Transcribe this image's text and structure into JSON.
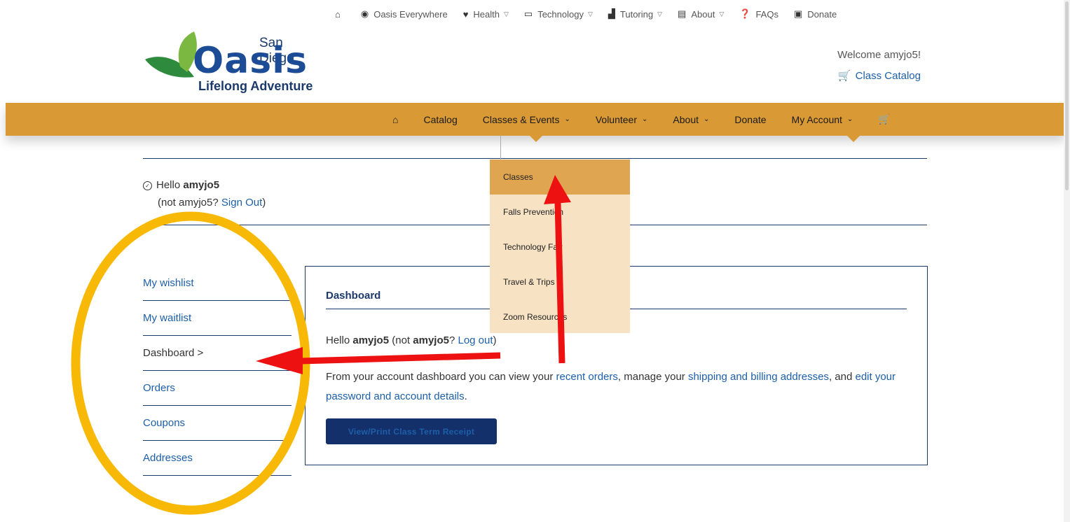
{
  "topnav": {
    "items": [
      {
        "label": "",
        "icon": "home-icon"
      },
      {
        "label": "Oasis Everywhere",
        "icon": "globe-icon"
      },
      {
        "label": "Health",
        "icon": "heart-icon",
        "dropdown": true
      },
      {
        "label": "Technology",
        "icon": "laptop-icon",
        "dropdown": true
      },
      {
        "label": "Tutoring",
        "icon": "teacher-icon",
        "dropdown": true
      },
      {
        "label": "About",
        "icon": "chalkboard-icon",
        "dropdown": true
      },
      {
        "label": "FAQs",
        "icon": "question-circle-icon"
      },
      {
        "label": "Donate",
        "icon": "gift-icon"
      }
    ]
  },
  "logo": {
    "line1": "San Diego",
    "line2": "Oasis",
    "line3": "Lifelong Adventure"
  },
  "header": {
    "welcome": "Welcome amyjo5!",
    "catalog_link": "Class Catalog"
  },
  "mainnav": {
    "catalog": "Catalog",
    "classes_events": "Classes & Events",
    "volunteer": "Volunteer",
    "about": "About",
    "donate": "Donate",
    "my_account": "My Account"
  },
  "account": {
    "hello_prefix": "Hello",
    "username": "amyjo5",
    "not_user": "(not amyjo5?",
    "sign_out": "Sign Out",
    "close_paren": ")"
  },
  "sidemenu": {
    "items": [
      "My wishlist",
      "My waitlist",
      "Dashboard >",
      "Orders",
      "Coupons",
      "Addresses"
    ]
  },
  "dashboard": {
    "title": "Dashboard",
    "hello": "Hello",
    "username": "amyjo5",
    "not": "(not",
    "username2": "amyjo5",
    "q": "?",
    "logout": "Log out",
    "close": ")",
    "p2_a": "From your account dashboard you can view your",
    "recent_orders": "recent orders",
    "p2_b": ", manage your",
    "addresses": "shipping and billing addresses",
    "p2_c": ", and",
    "account_details": "edit your password and account details",
    "p2_d": ".",
    "receipt_button": "View/Print Class Term Receipt"
  },
  "dropdown": {
    "items": [
      "Classes",
      "Falls Prevention",
      "Technology Fair",
      "Travel & Trips",
      "Zoom Resources"
    ]
  },
  "colors": {
    "nav_orange": "#d99934",
    "dropdown_bg": "#f7e3c4",
    "dropdown_highlight": "#e0a551",
    "link_blue": "#1c5fa8",
    "navy": "#13306b",
    "annotation_red": "#ee1111",
    "annotation_yellow": "#f7b905"
  }
}
